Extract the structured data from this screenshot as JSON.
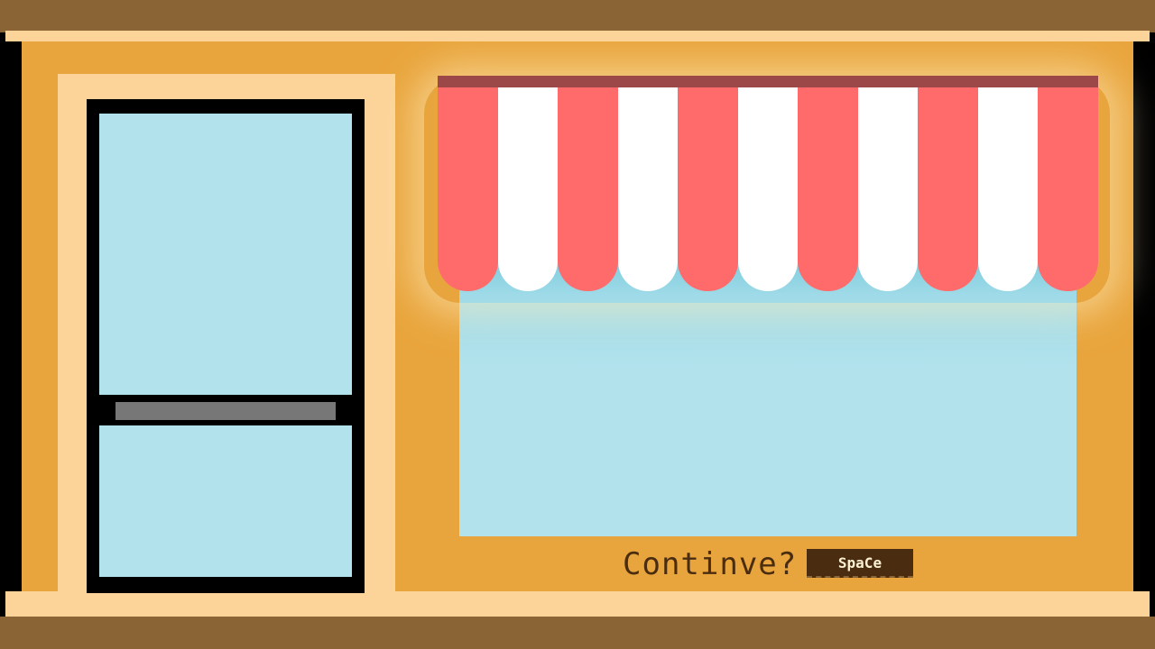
{
  "prompt": {
    "continue_label": "Continve?",
    "key_label": "SpaCe"
  },
  "awning": {
    "stripe_colors": [
      "#ff6b6b",
      "#ffffff",
      "#ff6b6b",
      "#ffffff",
      "#ff6b6b",
      "#ffffff",
      "#ff6b6b",
      "#ffffff",
      "#ff6b6b",
      "#ffffff",
      "#ff6b6b"
    ],
    "bar_color": "#9c4848"
  },
  "colors": {
    "facade": "#e9a53d",
    "trim": "#fcd49a",
    "roof": "#8b6436",
    "glass": "#b2e3ed",
    "door_frame": "#000000",
    "door_handle": "#777777",
    "text": "#4a2d10"
  }
}
